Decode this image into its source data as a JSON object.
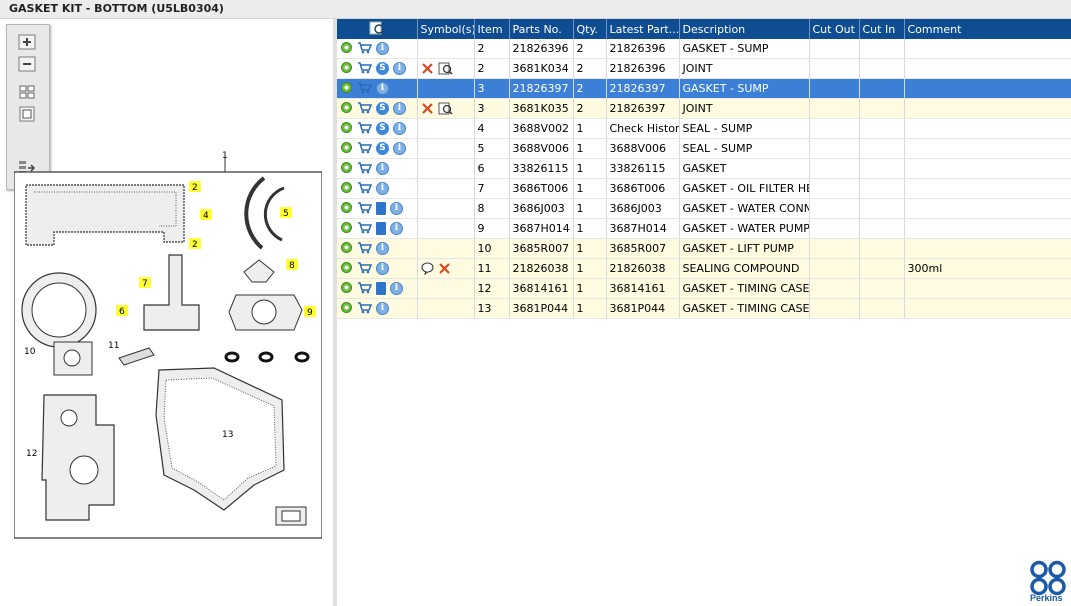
{
  "window": {
    "title": "GASKET KIT - BOTTOM (U5LB0304)"
  },
  "diagram": {
    "top_label": "1",
    "callouts": [
      "2",
      "2",
      "4",
      "5",
      "6",
      "7",
      "8",
      "9",
      "10",
      "11",
      "12",
      "13"
    ]
  },
  "grid": {
    "columns": [
      "Symbol(s)",
      "Item",
      "Parts No.",
      "Qty.",
      "Latest Part...",
      "Description",
      "Cut Out",
      "Cut In",
      "Comment"
    ],
    "rows": [
      {
        "symbols": "",
        "item": "2",
        "part": "21826396",
        "qty": "2",
        "latest": "21826396",
        "desc": "GASKET - SUMP",
        "cut_out": "",
        "cut_in": "",
        "comment": "",
        "style": "white",
        "s": false,
        "book": false,
        "sym_x": false,
        "sym_q": false
      },
      {
        "symbols": "",
        "item": "2",
        "part": "3681K034",
        "qty": "2",
        "latest": "21826396",
        "desc": "JOINT",
        "cut_out": "",
        "cut_in": "",
        "comment": "",
        "style": "white",
        "s": true,
        "book": false,
        "sym_x": true,
        "sym_q": false
      },
      {
        "symbols": "",
        "item": "3",
        "part": "21826397",
        "qty": "2",
        "latest": "21826397",
        "desc": "GASKET - SUMP",
        "cut_out": "",
        "cut_in": "",
        "comment": "",
        "style": "sel",
        "s": false,
        "book": false,
        "sym_x": false,
        "sym_q": false
      },
      {
        "symbols": "",
        "item": "3",
        "part": "3681K035",
        "qty": "2",
        "latest": "21826397",
        "desc": "JOINT",
        "cut_out": "",
        "cut_in": "",
        "comment": "",
        "style": "yellow",
        "s": true,
        "book": false,
        "sym_x": true,
        "sym_q": false
      },
      {
        "symbols": "",
        "item": "4",
        "part": "3688V002",
        "qty": "1",
        "latest": "Check History",
        "desc": "SEAL - SUMP",
        "cut_out": "",
        "cut_in": "",
        "comment": "",
        "style": "white",
        "s": true,
        "book": false,
        "sym_x": false,
        "sym_q": false
      },
      {
        "symbols": "",
        "item": "5",
        "part": "3688V006",
        "qty": "1",
        "latest": "3688V006",
        "desc": "SEAL - SUMP",
        "cut_out": "",
        "cut_in": "",
        "comment": "",
        "style": "white",
        "s": true,
        "book": false,
        "sym_x": false,
        "sym_q": false
      },
      {
        "symbols": "",
        "item": "6",
        "part": "33826115",
        "qty": "1",
        "latest": "33826115",
        "desc": "GASKET",
        "cut_out": "",
        "cut_in": "",
        "comment": "",
        "style": "white",
        "s": false,
        "book": false,
        "sym_x": false,
        "sym_q": false
      },
      {
        "symbols": "",
        "item": "7",
        "part": "3686T006",
        "qty": "1",
        "latest": "3686T006",
        "desc": "GASKET - OIL FILTER HEA",
        "cut_out": "",
        "cut_in": "",
        "comment": "",
        "style": "white",
        "s": false,
        "book": false,
        "sym_x": false,
        "sym_q": false
      },
      {
        "symbols": "",
        "item": "8",
        "part": "3686J003",
        "qty": "1",
        "latest": "3686J003",
        "desc": "GASKET - WATER CONNE",
        "cut_out": "",
        "cut_in": "",
        "comment": "",
        "style": "white",
        "s": false,
        "book": true,
        "sym_x": false,
        "sym_q": false
      },
      {
        "symbols": "",
        "item": "9",
        "part": "3687H014",
        "qty": "1",
        "latest": "3687H014",
        "desc": "GASKET - WATER PUMP",
        "cut_out": "",
        "cut_in": "",
        "comment": "",
        "style": "white",
        "s": false,
        "book": true,
        "sym_x": false,
        "sym_q": false
      },
      {
        "symbols": "",
        "item": "10",
        "part": "3685R007",
        "qty": "1",
        "latest": "3685R007",
        "desc": "GASKET - LIFT PUMP",
        "cut_out": "",
        "cut_in": "",
        "comment": "",
        "style": "yellow",
        "s": false,
        "book": false,
        "sym_x": false,
        "sym_q": false
      },
      {
        "symbols": "",
        "item": "11",
        "part": "21826038",
        "qty": "1",
        "latest": "21826038",
        "desc": "SEALING COMPOUND",
        "cut_out": "",
        "cut_in": "",
        "comment": "300ml",
        "style": "yellow",
        "s": false,
        "book": false,
        "sym_x": true,
        "sym_q": true
      },
      {
        "symbols": "",
        "item": "12",
        "part": "36814161",
        "qty": "1",
        "latest": "36814161",
        "desc": "GASKET - TIMING CASE",
        "cut_out": "",
        "cut_in": "",
        "comment": "",
        "style": "yellow",
        "s": false,
        "book": true,
        "sym_x": false,
        "sym_q": false
      },
      {
        "symbols": "",
        "item": "13",
        "part": "3681P044",
        "qty": "1",
        "latest": "3681P044",
        "desc": "GASKET - TIMING CASE C",
        "cut_out": "",
        "cut_in": "",
        "comment": "",
        "style": "yellow",
        "s": false,
        "book": false,
        "sym_x": false,
        "sym_q": false
      }
    ]
  },
  "brand": {
    "logo_text": "Perkins",
    "color": "#1a5aa8"
  }
}
